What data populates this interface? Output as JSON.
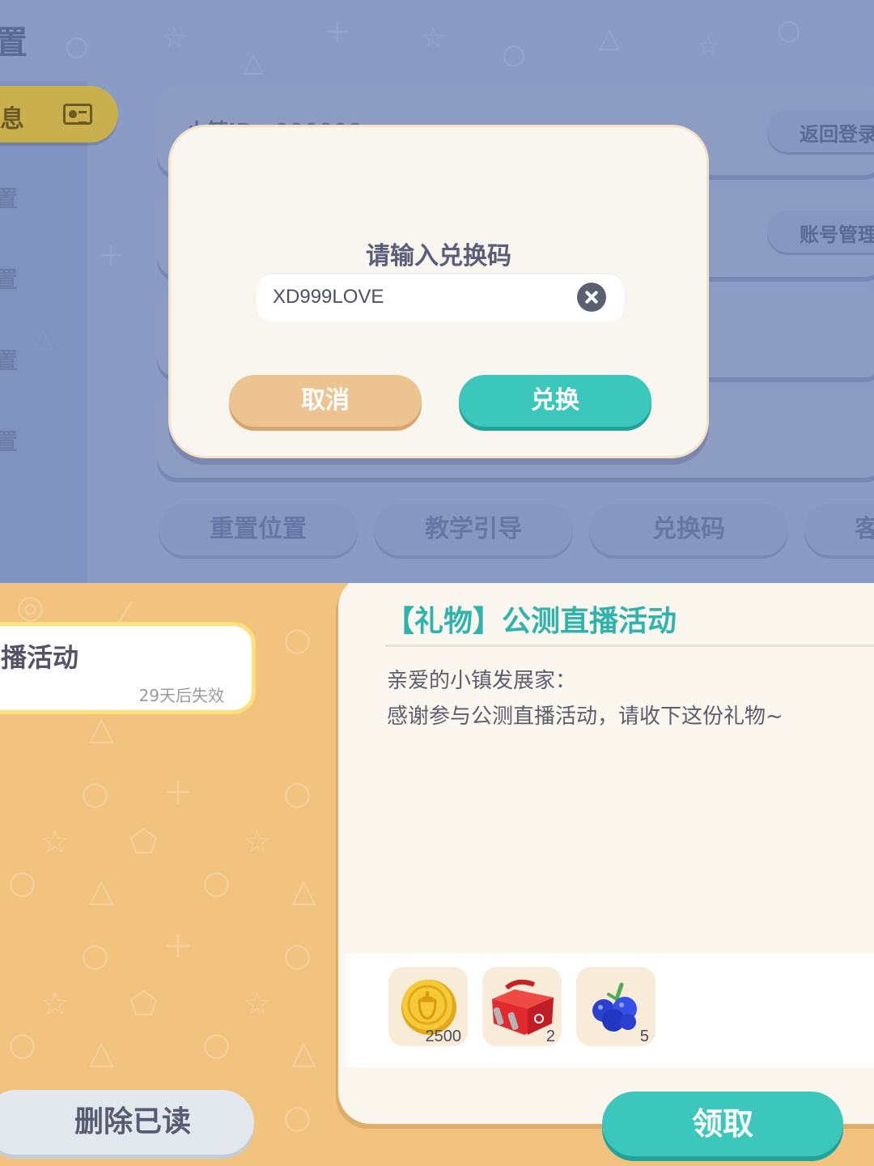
{
  "settings": {
    "title": "置",
    "sidebar": {
      "active_label": "息",
      "items": [
        "置",
        "置",
        "置",
        "置"
      ]
    },
    "cards": {
      "player_id_label": "小镇ID：000000",
      "back_to_login": "返回登录",
      "account_manage": "账号管理"
    },
    "bottom_buttons": [
      "重置位置",
      "教学引导",
      "兑换码",
      "客"
    ]
  },
  "dialog": {
    "title": "请输入兑换码",
    "code_value": "XD999LOVE",
    "cancel_label": "取消",
    "confirm_label": "兑换"
  },
  "mail": {
    "list_item": {
      "title": "播活动",
      "expire": "29天后失效"
    },
    "delete_read_label": "删除已读",
    "detail": {
      "title": "【礼物】公测直播活动",
      "greeting": "亲爱的小镇发展家：",
      "body": "感谢参与公测直播活动，请收下这份礼物~"
    },
    "rewards": [
      {
        "icon": "acorn-coin-icon",
        "count": "2500"
      },
      {
        "icon": "red-toolbox-icon",
        "count": "2"
      },
      {
        "icon": "blueberry-icon",
        "count": "5"
      }
    ],
    "claim_label": "领取"
  }
}
